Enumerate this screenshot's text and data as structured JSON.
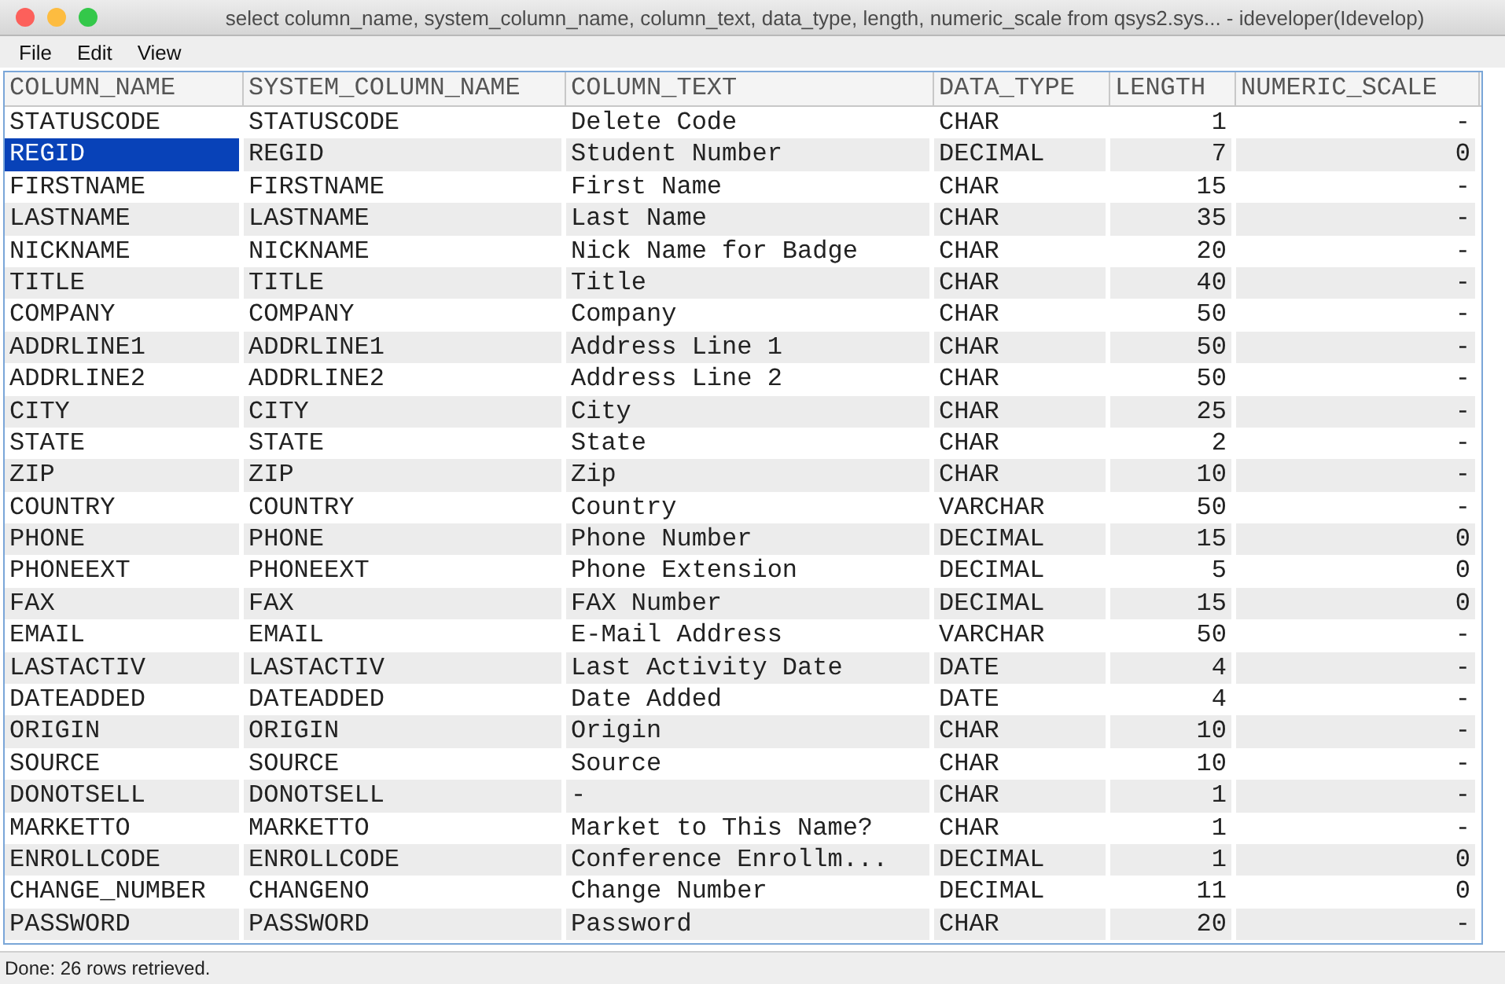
{
  "window": {
    "title": "select column_name, system_column_name, column_text, data_type, length, numeric_scale from qsys2.sys... - ideveloper(Idevelop)"
  },
  "menu": [
    "File",
    "Edit",
    "View"
  ],
  "table": {
    "columns": [
      {
        "label": "COLUMN_NAME",
        "kind": "text"
      },
      {
        "label": "SYSTEM_COLUMN_NAME",
        "kind": "text"
      },
      {
        "label": "COLUMN_TEXT",
        "kind": "text"
      },
      {
        "label": "DATA_TYPE",
        "kind": "text"
      },
      {
        "label": "LENGTH",
        "kind": "number"
      },
      {
        "label": "NUMERIC_SCALE",
        "kind": "number"
      }
    ],
    "rows": [
      {
        "selected": false,
        "cells": [
          "STATUSCODE",
          "STATUSCODE",
          "Delete Code",
          "CHAR",
          "1",
          "-"
        ]
      },
      {
        "selected": true,
        "cells": [
          "REGID",
          "REGID",
          "Student Number",
          "DECIMAL",
          "7",
          "0"
        ]
      },
      {
        "selected": false,
        "cells": [
          "FIRSTNAME",
          "FIRSTNAME",
          "First Name",
          "CHAR",
          "15",
          "-"
        ]
      },
      {
        "selected": false,
        "cells": [
          "LASTNAME",
          "LASTNAME",
          "Last Name",
          "CHAR",
          "35",
          "-"
        ]
      },
      {
        "selected": false,
        "cells": [
          "NICKNAME",
          "NICKNAME",
          "Nick Name for Badge",
          "CHAR",
          "20",
          "-"
        ]
      },
      {
        "selected": false,
        "cells": [
          "TITLE",
          "TITLE",
          "Title",
          "CHAR",
          "40",
          "-"
        ]
      },
      {
        "selected": false,
        "cells": [
          "COMPANY",
          "COMPANY",
          "Company",
          "CHAR",
          "50",
          "-"
        ]
      },
      {
        "selected": false,
        "cells": [
          "ADDRLINE1",
          "ADDRLINE1",
          "Address Line 1",
          "CHAR",
          "50",
          "-"
        ]
      },
      {
        "selected": false,
        "cells": [
          "ADDRLINE2",
          "ADDRLINE2",
          "Address Line 2",
          "CHAR",
          "50",
          "-"
        ]
      },
      {
        "selected": false,
        "cells": [
          "CITY",
          "CITY",
          "City",
          "CHAR",
          "25",
          "-"
        ]
      },
      {
        "selected": false,
        "cells": [
          "STATE",
          "STATE",
          "State",
          "CHAR",
          "2",
          "-"
        ]
      },
      {
        "selected": false,
        "cells": [
          "ZIP",
          "ZIP",
          "Zip",
          "CHAR",
          "10",
          "-"
        ]
      },
      {
        "selected": false,
        "cells": [
          "COUNTRY",
          "COUNTRY",
          "Country",
          "VARCHAR",
          "50",
          "-"
        ]
      },
      {
        "selected": false,
        "cells": [
          "PHONE",
          "PHONE",
          "Phone Number",
          "DECIMAL",
          "15",
          "0"
        ]
      },
      {
        "selected": false,
        "cells": [
          "PHONEEXT",
          "PHONEEXT",
          "Phone Extension",
          "DECIMAL",
          "5",
          "0"
        ]
      },
      {
        "selected": false,
        "cells": [
          "FAX",
          "FAX",
          "FAX Number",
          "DECIMAL",
          "15",
          "0"
        ]
      },
      {
        "selected": false,
        "cells": [
          "EMAIL",
          "EMAIL",
          "E-Mail Address",
          "VARCHAR",
          "50",
          "-"
        ]
      },
      {
        "selected": false,
        "cells": [
          "LASTACTIV",
          "LASTACTIV",
          "Last Activity Date",
          "DATE",
          "4",
          "-"
        ]
      },
      {
        "selected": false,
        "cells": [
          "DATEADDED",
          "DATEADDED",
          "Date Added",
          "DATE",
          "4",
          "-"
        ]
      },
      {
        "selected": false,
        "cells": [
          "ORIGIN",
          "ORIGIN",
          "Origin",
          "CHAR",
          "10",
          "-"
        ]
      },
      {
        "selected": false,
        "cells": [
          "SOURCE",
          "SOURCE",
          "Source",
          "CHAR",
          "10",
          "-"
        ]
      },
      {
        "selected": false,
        "cells": [
          "DONOTSELL",
          "DONOTSELL",
          "-",
          "CHAR",
          "1",
          "-"
        ]
      },
      {
        "selected": false,
        "cells": [
          "MARKETTO",
          "MARKETTO",
          "Market to This Name?",
          "CHAR",
          "1",
          "-"
        ]
      },
      {
        "selected": false,
        "cells": [
          "ENROLLCODE",
          "ENROLLCODE",
          "Conference Enrollm...",
          "DECIMAL",
          "1",
          "0"
        ]
      },
      {
        "selected": false,
        "cells": [
          "CHANGE_NUMBER",
          "CHANGENO",
          "Change Number",
          "DECIMAL",
          "11",
          "0"
        ]
      },
      {
        "selected": false,
        "cells": [
          "PASSWORD",
          "PASSWORD",
          "Password",
          "CHAR",
          "20",
          "-"
        ]
      }
    ]
  },
  "status_bar": "Done: 26 rows retrieved."
}
